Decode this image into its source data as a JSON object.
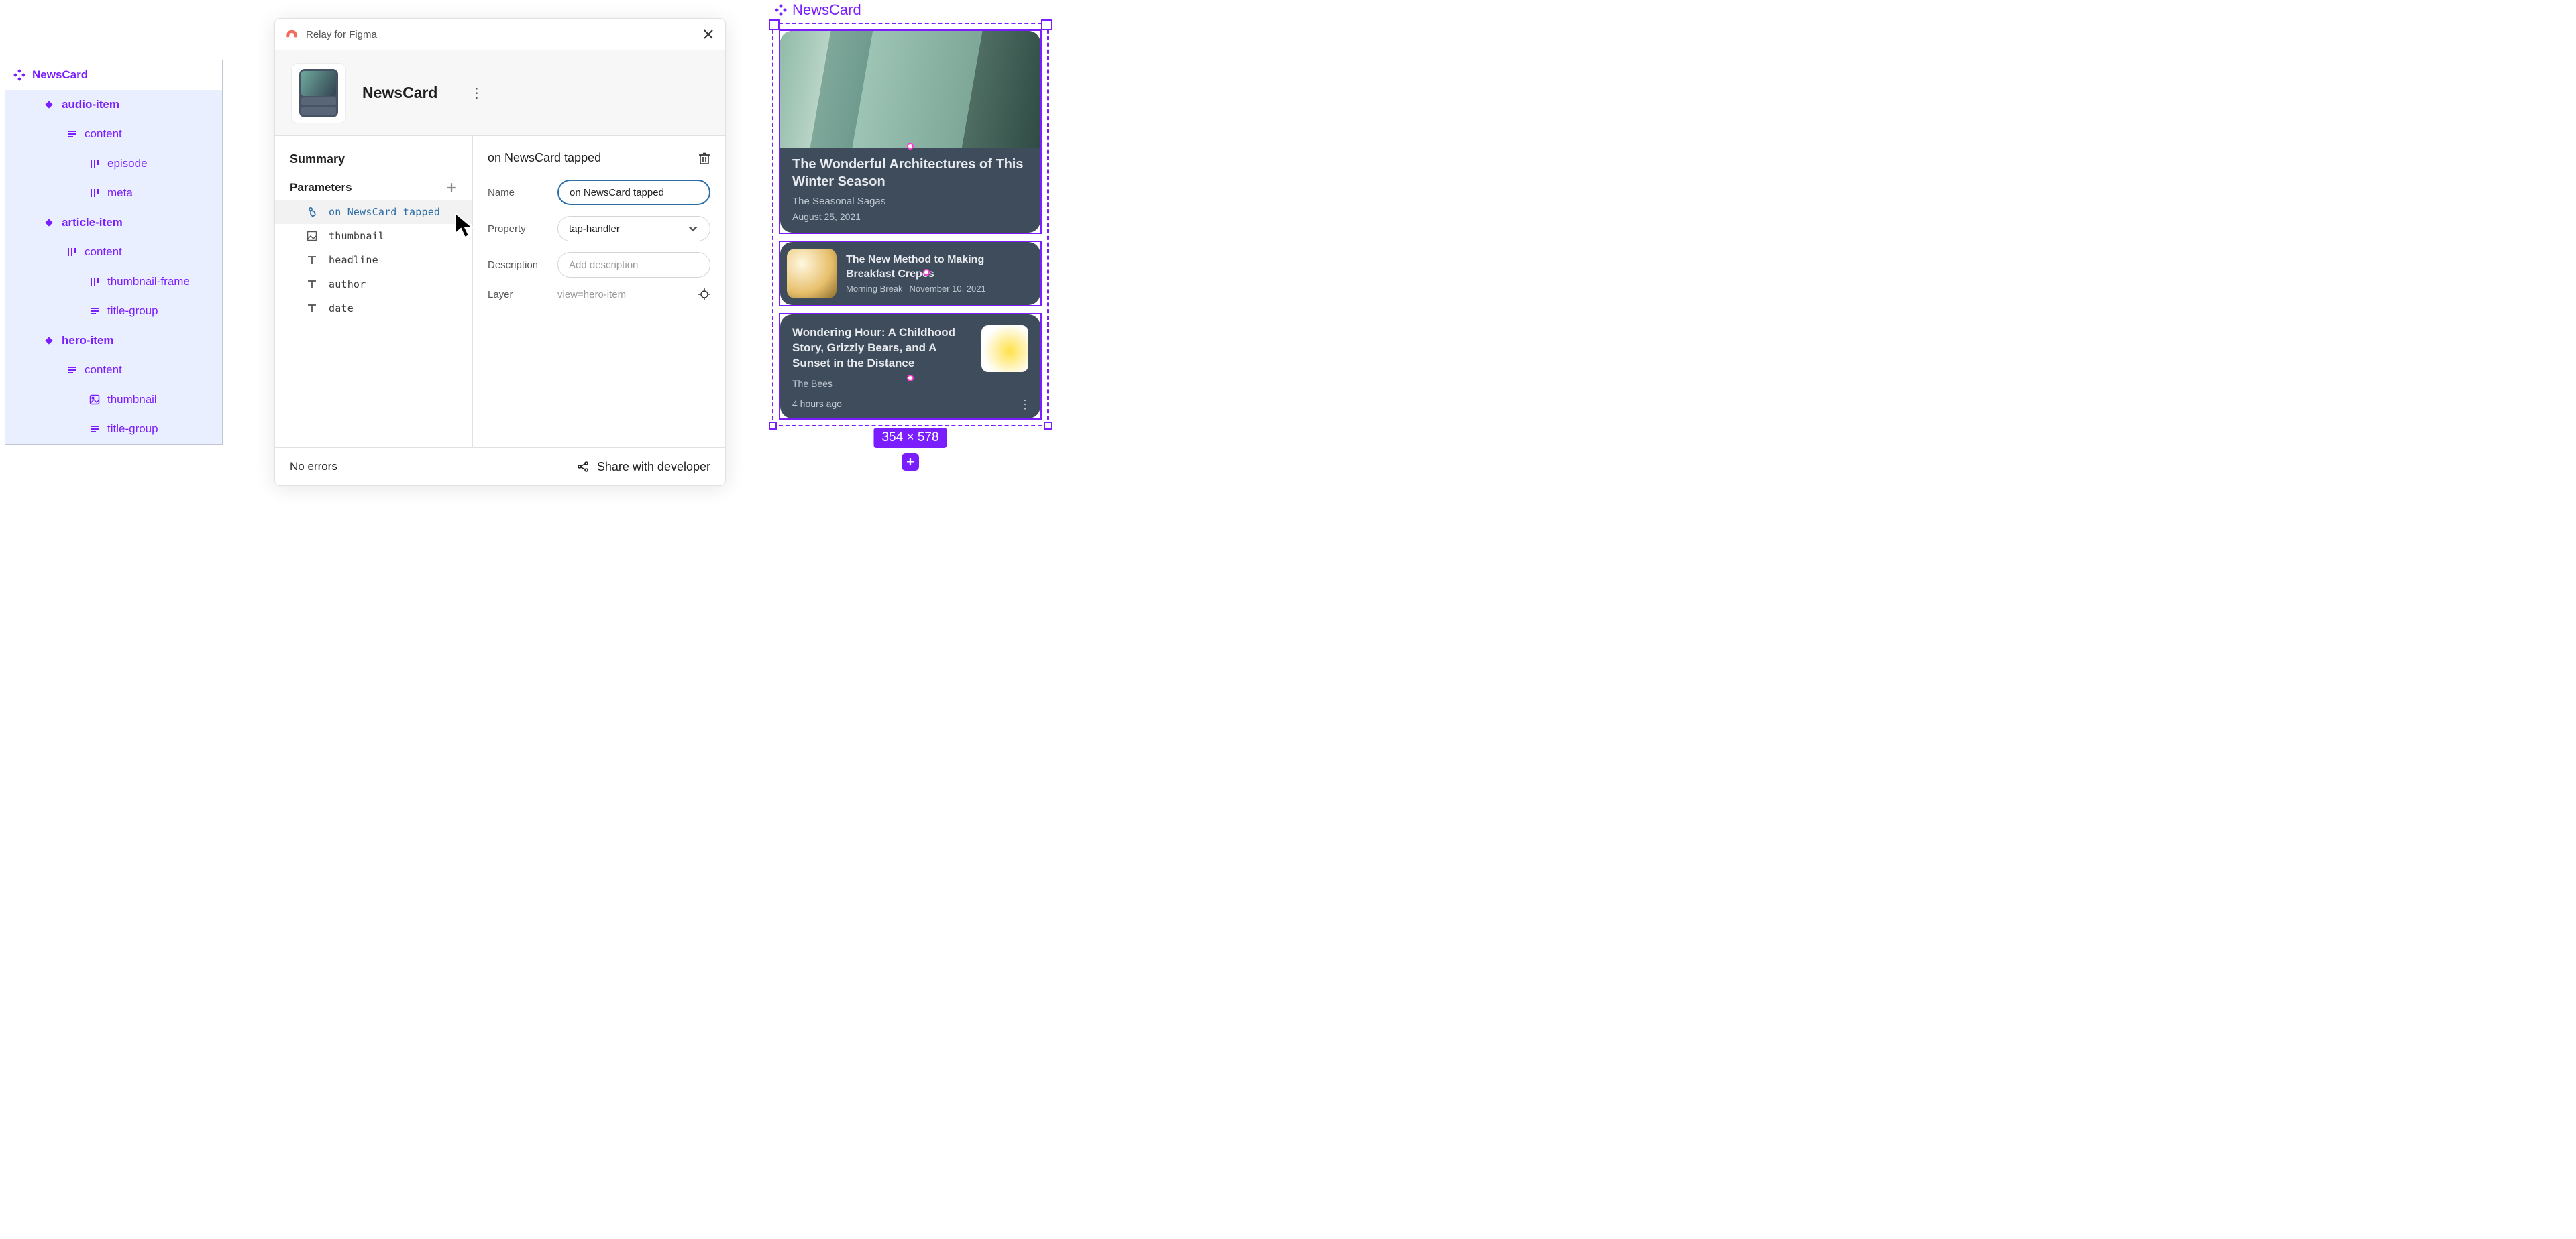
{
  "layers": {
    "root": "NewsCard",
    "items": [
      {
        "indent": 0,
        "icon": "diamond4",
        "label": "NewsCard",
        "bold": true,
        "sel": false
      },
      {
        "indent": 1,
        "icon": "diamond",
        "label": "audio-item",
        "bold": true,
        "sel": true
      },
      {
        "indent": 2,
        "icon": "lines",
        "label": "content",
        "bold": false,
        "sel": true
      },
      {
        "indent": 3,
        "icon": "bars",
        "label": "episode",
        "bold": false,
        "sel": true
      },
      {
        "indent": 3,
        "icon": "bars",
        "label": "meta",
        "bold": false,
        "sel": true
      },
      {
        "indent": 1,
        "icon": "diamond",
        "label": "article-item",
        "bold": true,
        "sel": true
      },
      {
        "indent": 2,
        "icon": "bars",
        "label": "content",
        "bold": false,
        "sel": true
      },
      {
        "indent": 3,
        "icon": "bars",
        "label": "thumbnail-frame",
        "bold": false,
        "sel": true
      },
      {
        "indent": 3,
        "icon": "lines",
        "label": "title-group",
        "bold": false,
        "sel": true
      },
      {
        "indent": 1,
        "icon": "diamond",
        "label": "hero-item",
        "bold": true,
        "sel": true
      },
      {
        "indent": 2,
        "icon": "lines",
        "label": "content",
        "bold": false,
        "sel": true
      },
      {
        "indent": 3,
        "icon": "image",
        "label": "thumbnail",
        "bold": false,
        "sel": true
      },
      {
        "indent": 3,
        "icon": "lines",
        "label": "title-group",
        "bold": false,
        "sel": true
      }
    ]
  },
  "plugin": {
    "name": "Relay for Figma",
    "component": "NewsCard",
    "left": {
      "summary_label": "Summary",
      "parameters_label": "Parameters",
      "params": [
        {
          "icon": "tap",
          "label": "on NewsCard tapped",
          "sel": true
        },
        {
          "icon": "image",
          "label": "thumbnail",
          "sel": false
        },
        {
          "icon": "text",
          "label": "headline",
          "sel": false
        },
        {
          "icon": "text",
          "label": "author",
          "sel": false
        },
        {
          "icon": "text",
          "label": "date",
          "sel": false
        }
      ]
    },
    "right": {
      "title": "on NewsCard tapped",
      "fields": {
        "name_label": "Name",
        "name_value": "on NewsCard tapped",
        "property_label": "Property",
        "property_value": "tap-handler",
        "description_label": "Description",
        "description_placeholder": "Add description",
        "layer_label": "Layer",
        "layer_value": "view=hero-item"
      }
    },
    "footer": {
      "errors": "No errors",
      "share": "Share with developer"
    }
  },
  "canvas": {
    "label": "NewsCard",
    "size": "354 × 578",
    "hero": {
      "headline": "The Wonderful Architectures of This Winter Season",
      "author": "The Seasonal Sagas",
      "date": "August 25, 2021"
    },
    "article": {
      "headline": "The New Method to Making Breakfast Crepes",
      "author": "Morning Break",
      "date": "November 10, 2021"
    },
    "audio": {
      "headline": "Wondering Hour: A Childhood Story, Grizzly Bears, and A Sunset in the Distance",
      "author": "The Bees",
      "date": "4 hours ago"
    }
  }
}
